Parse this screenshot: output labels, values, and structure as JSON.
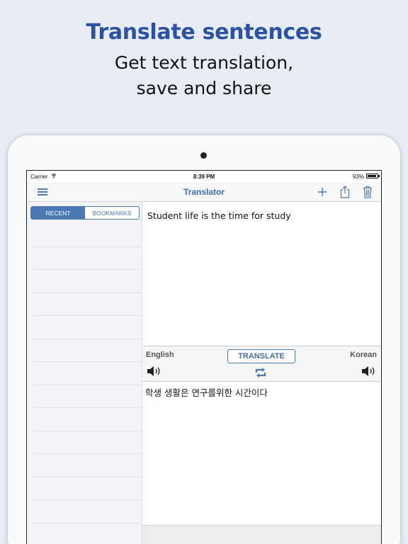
{
  "promo": {
    "headline": "Translate sentences",
    "subline1": "Get text translation,",
    "subline2": "save and share"
  },
  "status_bar": {
    "carrier": "Carrier",
    "time": "8:39 PM",
    "battery_percent": "93%",
    "battery_level": 0.93
  },
  "navbar": {
    "title": "Translator",
    "icons": [
      "menu-icon",
      "plus-icon",
      "share-icon",
      "trash-icon"
    ]
  },
  "sidebar": {
    "tabs": [
      {
        "label": "RECENT",
        "active": true
      },
      {
        "label": "BOOKMARKS",
        "active": false
      }
    ],
    "items": []
  },
  "translator": {
    "input_text": "Student life is the time for study",
    "source_language": "English",
    "target_language": "Korean",
    "translate_label": "TRANSLATE",
    "output_text": "학생 생활은 연구를위한 시간이다"
  },
  "colors": {
    "accent": "#4a79b4",
    "headline": "#2b52a4",
    "background": "#e8ecf5"
  }
}
